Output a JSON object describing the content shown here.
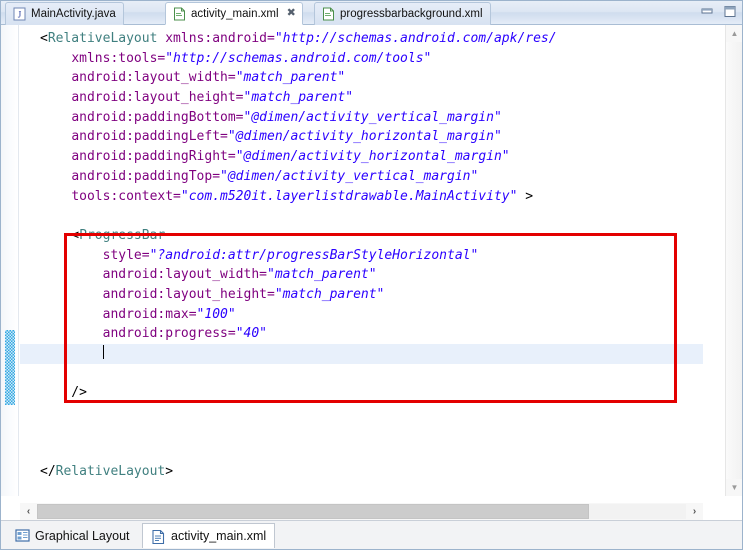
{
  "window": {
    "minimize_label": "minimize",
    "maximize_label": "restore"
  },
  "tabs": [
    {
      "label": "MainActivity.java",
      "icon": "java-file-icon",
      "active": false,
      "closeable": false
    },
    {
      "label": "activity_main.xml",
      "icon": "xml-file-icon",
      "active": true,
      "closeable": true,
      "close_glyph": "✖"
    },
    {
      "label": "progressbarbackground.xml",
      "icon": "xml-file-icon",
      "active": false,
      "closeable": false
    }
  ],
  "editor": {
    "language": "xml",
    "lines": [
      [
        {
          "t": "<",
          "c": "punct"
        },
        {
          "t": "RelativeLayout",
          "c": "tagname"
        },
        {
          "t": " ",
          "c": "punct"
        },
        {
          "t": "xmlns:android=",
          "c": "attr"
        },
        {
          "t": "\"http://schemas.android.com/apk/res/",
          "c": "val"
        }
      ],
      [
        {
          "t": "    ",
          "c": "punct"
        },
        {
          "t": "xmlns:tools=",
          "c": "attr"
        },
        {
          "t": "\"http://schemas.android.com/tools\"",
          "c": "val"
        }
      ],
      [
        {
          "t": "    ",
          "c": "punct"
        },
        {
          "t": "android:layout_width=",
          "c": "attr"
        },
        {
          "t": "\"match_parent\"",
          "c": "val"
        }
      ],
      [
        {
          "t": "    ",
          "c": "punct"
        },
        {
          "t": "android:layout_height=",
          "c": "attr"
        },
        {
          "t": "\"match_parent\"",
          "c": "val"
        }
      ],
      [
        {
          "t": "    ",
          "c": "punct"
        },
        {
          "t": "android:paddingBottom=",
          "c": "attr"
        },
        {
          "t": "\"@dimen/activity_vertical_margin\"",
          "c": "val"
        }
      ],
      [
        {
          "t": "    ",
          "c": "punct"
        },
        {
          "t": "android:paddingLeft=",
          "c": "attr"
        },
        {
          "t": "\"@dimen/activity_horizontal_margin\"",
          "c": "val"
        }
      ],
      [
        {
          "t": "    ",
          "c": "punct"
        },
        {
          "t": "android:paddingRight=",
          "c": "attr"
        },
        {
          "t": "\"@dimen/activity_horizontal_margin\"",
          "c": "val"
        }
      ],
      [
        {
          "t": "    ",
          "c": "punct"
        },
        {
          "t": "android:paddingTop=",
          "c": "attr"
        },
        {
          "t": "\"@dimen/activity_vertical_margin\"",
          "c": "val"
        }
      ],
      [
        {
          "t": "    ",
          "c": "punct"
        },
        {
          "t": "tools:context=",
          "c": "attr"
        },
        {
          "t": "\"com.m520it.layerlistdrawable.MainActivity\"",
          "c": "val"
        },
        {
          "t": " >",
          "c": "punct"
        }
      ],
      [],
      [
        {
          "t": "    <",
          "c": "punct"
        },
        {
          "t": "ProgressBar",
          "c": "tagname"
        }
      ],
      [
        {
          "t": "        ",
          "c": "punct"
        },
        {
          "t": "style=",
          "c": "attr"
        },
        {
          "t": "\"?android:attr/progressBarStyleHorizontal\"",
          "c": "val"
        }
      ],
      [
        {
          "t": "        ",
          "c": "punct"
        },
        {
          "t": "android:layout_width=",
          "c": "attr"
        },
        {
          "t": "\"match_parent\"",
          "c": "val"
        }
      ],
      [
        {
          "t": "        ",
          "c": "punct"
        },
        {
          "t": "android:layout_height=",
          "c": "attr"
        },
        {
          "t": "\"match_parent\"",
          "c": "val"
        }
      ],
      [
        {
          "t": "        ",
          "c": "punct"
        },
        {
          "t": "android:max=",
          "c": "attr"
        },
        {
          "t": "\"100\"",
          "c": "val"
        }
      ],
      [
        {
          "t": "        ",
          "c": "punct"
        },
        {
          "t": "android:progress=",
          "c": "attr"
        },
        {
          "t": "\"40\"",
          "c": "val"
        }
      ],
      [
        {
          "t": "        ",
          "c": "punct"
        },
        {
          "t": "CURSOR",
          "c": "cursor"
        }
      ],
      [],
      [
        {
          "t": "    />",
          "c": "punct"
        }
      ],
      [],
      [],
      [],
      [
        {
          "t": "</",
          "c": "punct"
        },
        {
          "t": "RelativeLayout",
          "c": "tagname"
        },
        {
          "t": ">",
          "c": "punct"
        }
      ]
    ],
    "current_line_index": 16,
    "annotation": {
      "shape": "rectangle",
      "color": "#e30000",
      "covers_lines": "ProgressBar element block"
    }
  },
  "scrollbars": {
    "vertical_up_glyph": "▲",
    "vertical_down_glyph": "▼",
    "horizontal_left_glyph": "‹",
    "horizontal_right_glyph": "›",
    "horizontal_thumb_percent": 85
  },
  "bottom_tabs": [
    {
      "label": "Graphical Layout",
      "icon": "layout-grid-icon",
      "active": false
    },
    {
      "label": "activity_main.xml",
      "icon": "xml-doc-icon",
      "active": true
    }
  ],
  "colors": {
    "tag": "#3f7f7f",
    "attribute": "#7f007f",
    "value": "#2a00ff",
    "annotation": "#e30000",
    "current_line": "#e8f0fb",
    "marker": "#2aa4e0"
  }
}
